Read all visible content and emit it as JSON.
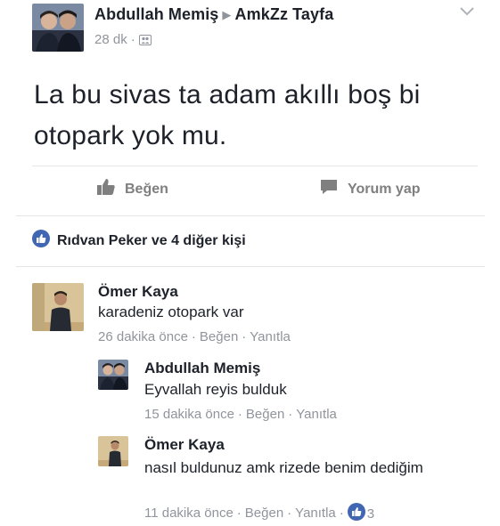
{
  "post": {
    "author": "Abdullah Memiş",
    "target_group": "AmkZz Tayfa",
    "time": "28 dk",
    "audience_icon": "group-audience-icon",
    "text": "La bu sivas ta adam akıllı boş bi otopark yok mu."
  },
  "actions": {
    "like_label": "Beğen",
    "comment_label": "Yorum yap"
  },
  "reactions": {
    "summary": "Rıdvan Peker ve 4 diğer kişi"
  },
  "comments": [
    {
      "name": "Ömer Kaya",
      "text": "karadeniz otopark var",
      "time": "26 dakika önce",
      "like": "Beğen",
      "reply": "Yanıtla"
    },
    {
      "name": "Abdullah Memiş",
      "text": "Eyvallah reyis bulduk",
      "time": "15 dakika önce",
      "like": "Beğen",
      "reply": "Yanıtla"
    },
    {
      "name": "Ömer Kaya",
      "text": "nasıl buldunuz amk rizede benim dediğim",
      "time": "11 dakika önce",
      "like": "Beğen",
      "reply": "Yanıtla",
      "like_count": "3"
    }
  ],
  "colors": {
    "text": "#1d2129",
    "meta": "#90949c",
    "brand_blue": "#4267b2",
    "divider": "#e5e6e9"
  }
}
